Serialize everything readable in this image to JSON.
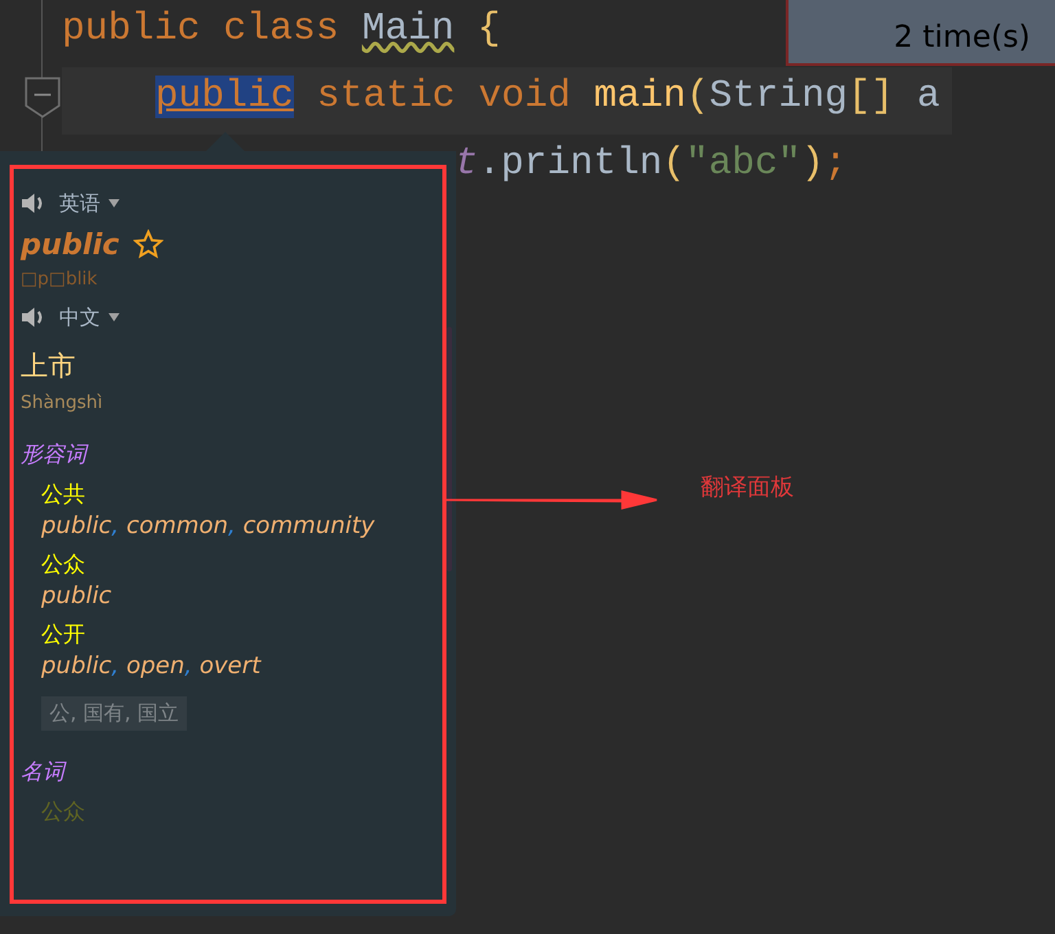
{
  "editor": {
    "lines": [
      {
        "current": false,
        "covered_start": false,
        "tokens": [
          {
            "text": "public ",
            "kind": "keyword"
          },
          {
            "text": "class ",
            "kind": "keyword"
          },
          {
            "text": "Main",
            "kind": "class",
            "warning": true
          },
          {
            "text": " {",
            "kind": "brace"
          }
        ]
      },
      {
        "current": true,
        "covered_start": false,
        "indented": true,
        "tokens": [
          {
            "text": "public",
            "kind": "keyword",
            "selected": true
          },
          {
            "text": " static void ",
            "kind": "keyword"
          },
          {
            "text": "main",
            "kind": "method"
          },
          {
            "text": "(",
            "kind": "brace"
          },
          {
            "text": "String",
            "kind": "plain"
          },
          {
            "text": "[]",
            "kind": "brace"
          },
          {
            "text": " a",
            "kind": "plain"
          }
        ]
      },
      {
        "current": false,
        "covered_start": true,
        "tokens": [
          {
            "text": "t",
            "kind": "field"
          },
          {
            "text": ".println",
            "kind": "plain"
          },
          {
            "text": "(",
            "kind": "brace"
          },
          {
            "text": "\"abc\"",
            "kind": "string"
          },
          {
            "text": ")",
            "kind": "brace"
          },
          {
            "text": ";",
            "kind": "keyword"
          }
        ]
      }
    ]
  },
  "notification": {
    "text": "2 time(s)"
  },
  "translation_popup": {
    "source": {
      "language": "英语",
      "word": "public",
      "starred": false,
      "phonetic": "□p□blik"
    },
    "target": {
      "language": "中文",
      "translation": "上市",
      "pinyin": "Shàngshì"
    },
    "parts_of_speech": [
      {
        "name": "形容词",
        "entries": [
          {
            "word": "公共",
            "faded": false,
            "meanings": "public, common, community"
          },
          {
            "word": "公众",
            "faded": false,
            "meanings": "public"
          },
          {
            "word": "公开",
            "faded": false,
            "meanings": "public, open, overt"
          }
        ],
        "synonyms": "公, 国有, 国立"
      },
      {
        "name": "名词",
        "entries": [
          {
            "word": "公众",
            "faded": true
          }
        ]
      }
    ]
  },
  "annotation": {
    "label": "翻译面板"
  }
}
